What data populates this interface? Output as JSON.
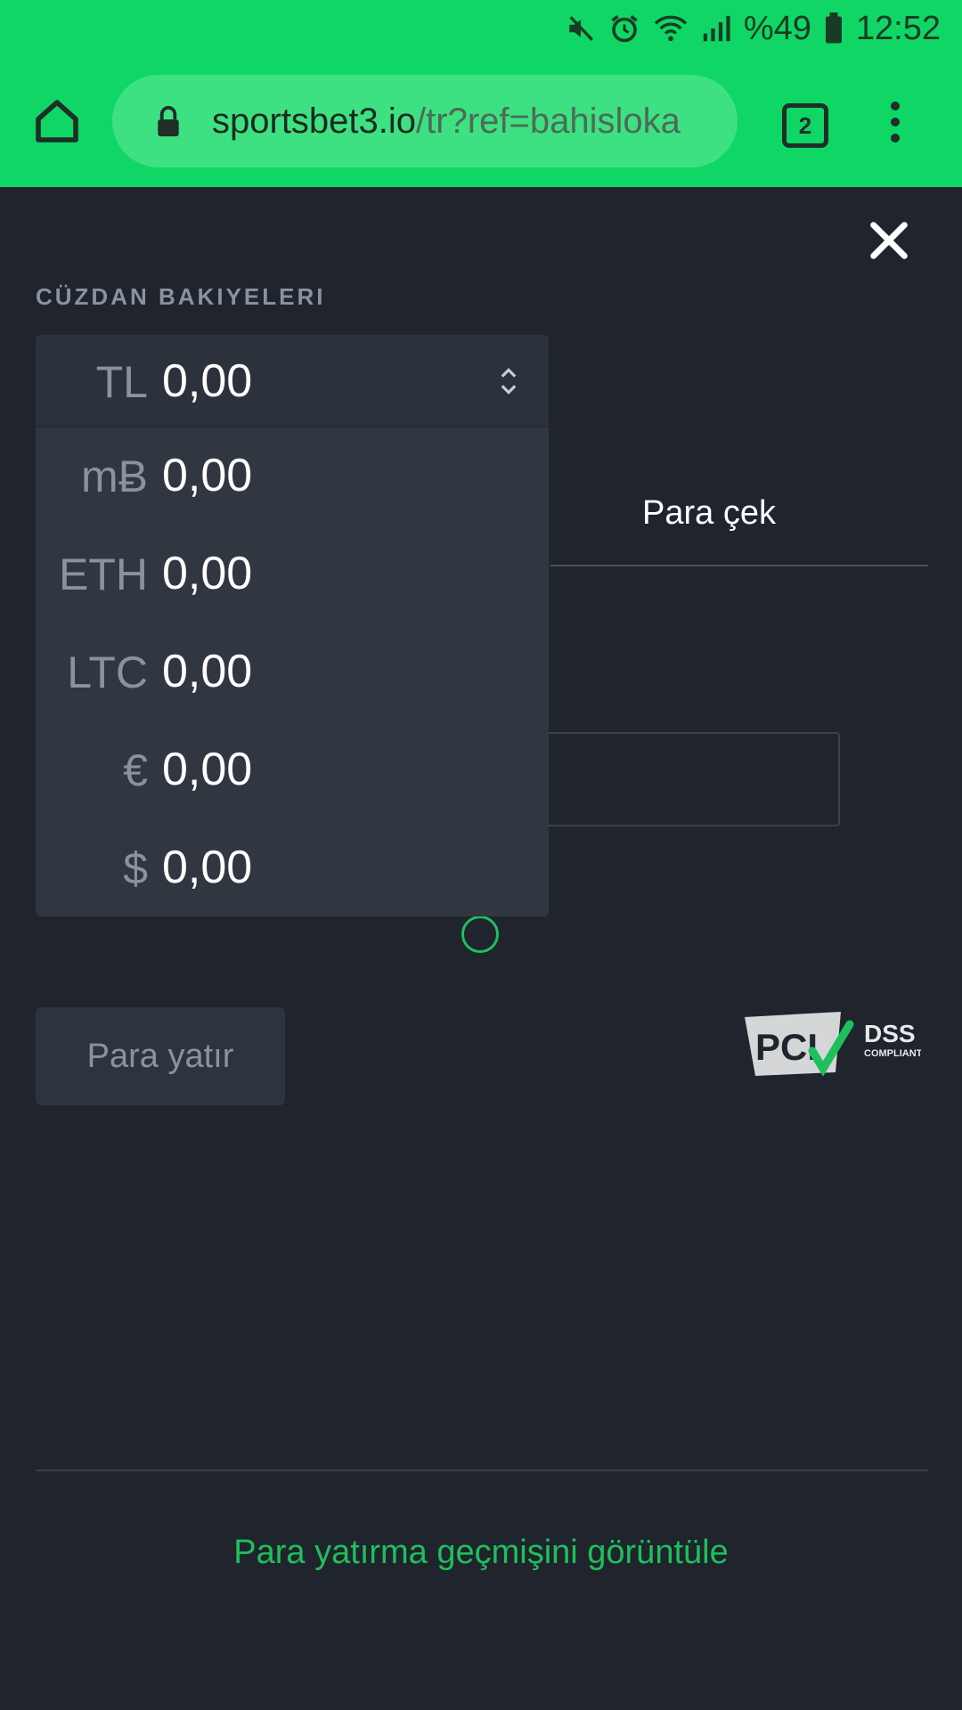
{
  "status_bar": {
    "battery_percent": "%49",
    "time": "12:52"
  },
  "browser": {
    "url_domain": "sportsbet3.io",
    "url_path": "/tr?ref=bahisloka",
    "tab_count": "2"
  },
  "wallet": {
    "section_label": "CÜZDAN BAKIYELERI",
    "selected": {
      "currency": "TL",
      "amount": "0,00"
    },
    "options": [
      {
        "currency": "mɃ",
        "amount": "0,00"
      },
      {
        "currency": "ETH",
        "amount": "0,00"
      },
      {
        "currency": "LTC",
        "amount": "0,00"
      },
      {
        "currency": "€",
        "amount": "0,00"
      },
      {
        "currency": "$",
        "amount": "0,00"
      }
    ]
  },
  "tabs": {
    "withdraw": "Para çek"
  },
  "deposit_button": "Para yatır",
  "pci": {
    "logo_text": "PCI",
    "dss": "DSS",
    "compliant": "COMPLIANT"
  },
  "history_link": "Para yatırma geçmişini görüntüle",
  "colors": {
    "accent": "#0fd665",
    "link": "#1fbf5c",
    "background": "#1f242d"
  }
}
